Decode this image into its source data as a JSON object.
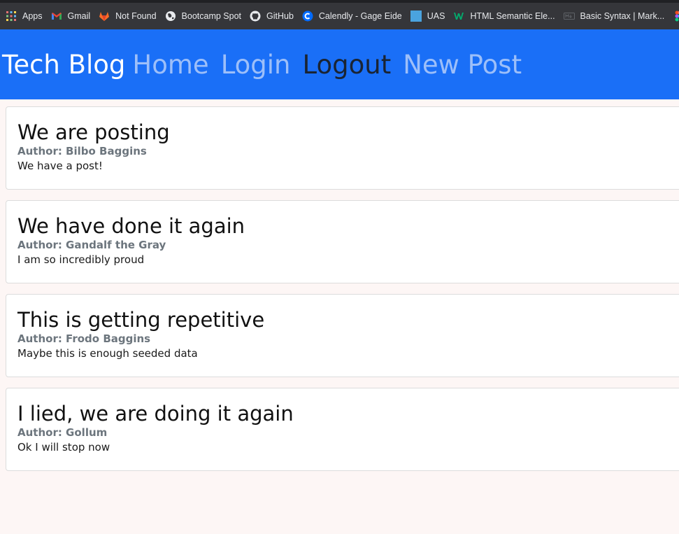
{
  "bookmarks": [
    {
      "label": "Apps",
      "icon": "apps-grid-icon"
    },
    {
      "label": "Gmail",
      "icon": "gmail-icon"
    },
    {
      "label": "Not Found",
      "icon": "gitlab-icon"
    },
    {
      "label": "Bootcamp Spot",
      "icon": "globe-icon"
    },
    {
      "label": "GitHub",
      "icon": "github-icon"
    },
    {
      "label": "Calendly - Gage Eide",
      "icon": "calendly-icon"
    },
    {
      "label": "UAS",
      "icon": "uas-icon"
    },
    {
      "label": "HTML Semantic Ele...",
      "icon": "w3schools-icon"
    },
    {
      "label": "Basic Syntax | Mark...",
      "icon": "markdown-icon"
    }
  ],
  "navbar": {
    "brand": "Tech Blog",
    "links": [
      {
        "label": "Home",
        "active": false
      },
      {
        "label": "Login",
        "active": false
      },
      {
        "label": "Logout",
        "active": true
      },
      {
        "label": "New Post",
        "active": false
      }
    ]
  },
  "posts": [
    {
      "title": "We are posting",
      "author": "Author: Bilbo Baggins",
      "body": "We have a post!"
    },
    {
      "title": "We have done it again",
      "author": "Author: Gandalf the Gray",
      "body": "I am so incredibly proud"
    },
    {
      "title": "This is getting repetitive",
      "author": "Author: Frodo Baggins",
      "body": "Maybe this is enough seeded data"
    },
    {
      "title": "I lied, we are doing it again",
      "author": "Author: Gollum",
      "body": "Ok I will stop now"
    }
  ],
  "colors": {
    "navbar_bg": "#1a6ff7",
    "page_bg": "#fdf6f5",
    "link_inactive": "#9dbff9",
    "link_active": "#1a2433",
    "author_text": "#6c757d"
  }
}
